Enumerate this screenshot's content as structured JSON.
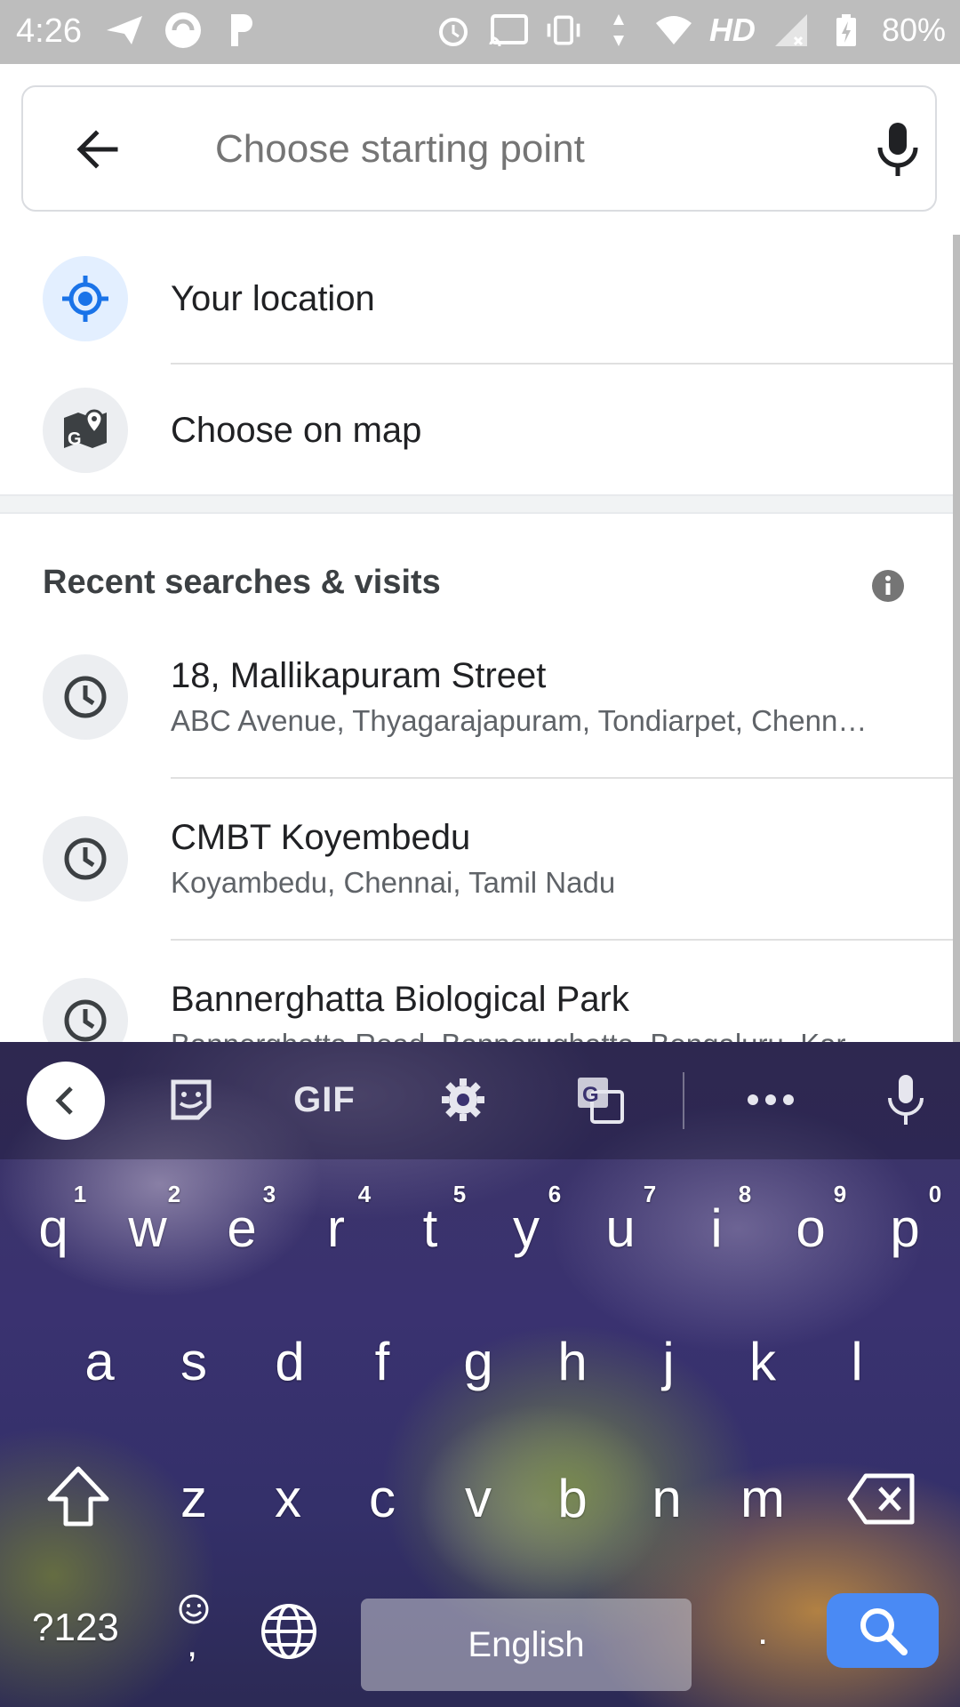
{
  "status_bar": {
    "time": "4:26",
    "network_label": "HD",
    "battery": "80%"
  },
  "search": {
    "placeholder": "Choose starting point",
    "value": ""
  },
  "quick_options": [
    {
      "label": "Your location",
      "icon": "my-location-icon"
    },
    {
      "label": "Choose on map",
      "icon": "map-pin-icon"
    }
  ],
  "recent": {
    "title": "Recent searches & visits",
    "items": [
      {
        "title": "18, Mallikapuram Street",
        "subtitle": "ABC Avenue, Thyagarajapuram, Tondiarpet, Chenn…"
      },
      {
        "title": "CMBT Koyembedu",
        "subtitle": "Koyambedu, Chennai, Tamil Nadu"
      },
      {
        "title": "Bannerghatta Biological Park",
        "subtitle": "Bannerghatta Road, Bannerughatta, Bengaluru, Kar…"
      }
    ]
  },
  "keyboard": {
    "toolbar": {
      "gif_label": "GIF"
    },
    "row1": [
      "q",
      "w",
      "e",
      "r",
      "t",
      "y",
      "u",
      "i",
      "o",
      "p"
    ],
    "row1_hints": [
      "1",
      "2",
      "3",
      "4",
      "5",
      "6",
      "7",
      "8",
      "9",
      "0"
    ],
    "row2": [
      "a",
      "s",
      "d",
      "f",
      "g",
      "h",
      "j",
      "k",
      "l"
    ],
    "row3": [
      "z",
      "x",
      "c",
      "v",
      "b",
      "n",
      "m"
    ],
    "symbols_label": "?123",
    "comma_label": ",",
    "space_label": "English",
    "period_label": ".",
    "colors": {
      "accent": "#4a8af4",
      "location_blue": "#1a73e8"
    }
  }
}
